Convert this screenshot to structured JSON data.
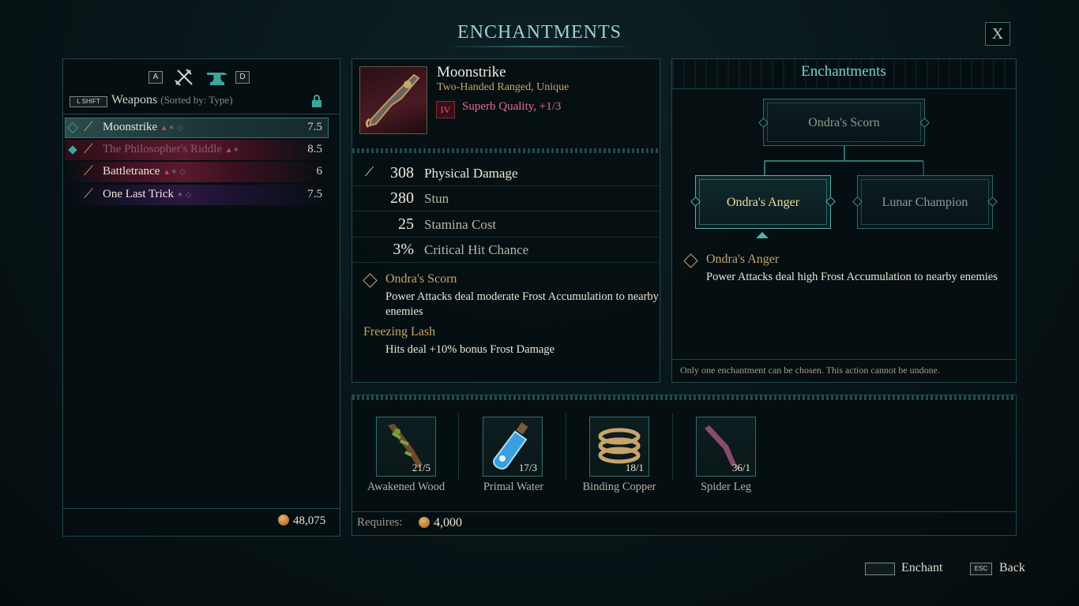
{
  "header": {
    "title": "ENCHANTMENTS",
    "close_label": "X"
  },
  "weapons_panel": {
    "key_left": "A",
    "key_right": "D",
    "shift_key": "L SHIFT",
    "label": "Weapons",
    "sort_note": "(Sorted by: Type)",
    "items": [
      {
        "name": "Moonstrike",
        "value": "7.5",
        "selected": true
      },
      {
        "name": "The Philosopher's Riddle",
        "value": "8.5",
        "selected": false
      },
      {
        "name": "Battletrance",
        "value": "6",
        "selected": false
      },
      {
        "name": "One Last Trick",
        "value": "7.5",
        "selected": false
      }
    ],
    "gold_total": "48,075"
  },
  "item": {
    "name": "Moonstrike",
    "type": "Two-Handed Ranged, Unique",
    "quality_tier": "IV",
    "quality_text": "Superb Quality, +1/3",
    "stats": [
      {
        "value": "308",
        "label": "Physical Damage"
      },
      {
        "value": "280",
        "label": "Stun"
      },
      {
        "value": "25",
        "label": "Stamina Cost"
      },
      {
        "value": "3%",
        "label": "Critical Hit Chance"
      }
    ],
    "enchant_name": "Ondra's Scorn",
    "enchant_desc": "Power Attacks deal moderate Frost Accumulation to nearby enemies",
    "trait_name": "Freezing Lash",
    "trait_desc": "Hits deal +10% bonus Frost Damage"
  },
  "enchant_tree": {
    "title": "Enchantments",
    "root": "Ondra's Scorn",
    "option_a": "Ondra's Anger",
    "option_b": "Lunar Champion",
    "selected_name": "Ondra's Anger",
    "selected_desc": "Power Attacks deal high Frost Accumulation to nearby enemies",
    "footer_note": "Only one enchantment can be chosen. This action cannot be undone."
  },
  "materials": [
    {
      "name": "Awakened Wood",
      "count": "21/5"
    },
    {
      "name": "Primal Water",
      "count": "17/3"
    },
    {
      "name": "Binding Copper",
      "count": "18/1"
    },
    {
      "name": "Spider Leg",
      "count": "36/1"
    }
  ],
  "requires": {
    "label": "Requires:",
    "value": "4,000"
  },
  "prompts": {
    "enchant_key": "",
    "enchant_label": "Enchant",
    "back_key": "ESC",
    "back_label": "Back"
  },
  "colors": {
    "accent_teal": "#7fd0c8",
    "gold": "#c7a46a",
    "quality_pink": "#e86a8a"
  }
}
